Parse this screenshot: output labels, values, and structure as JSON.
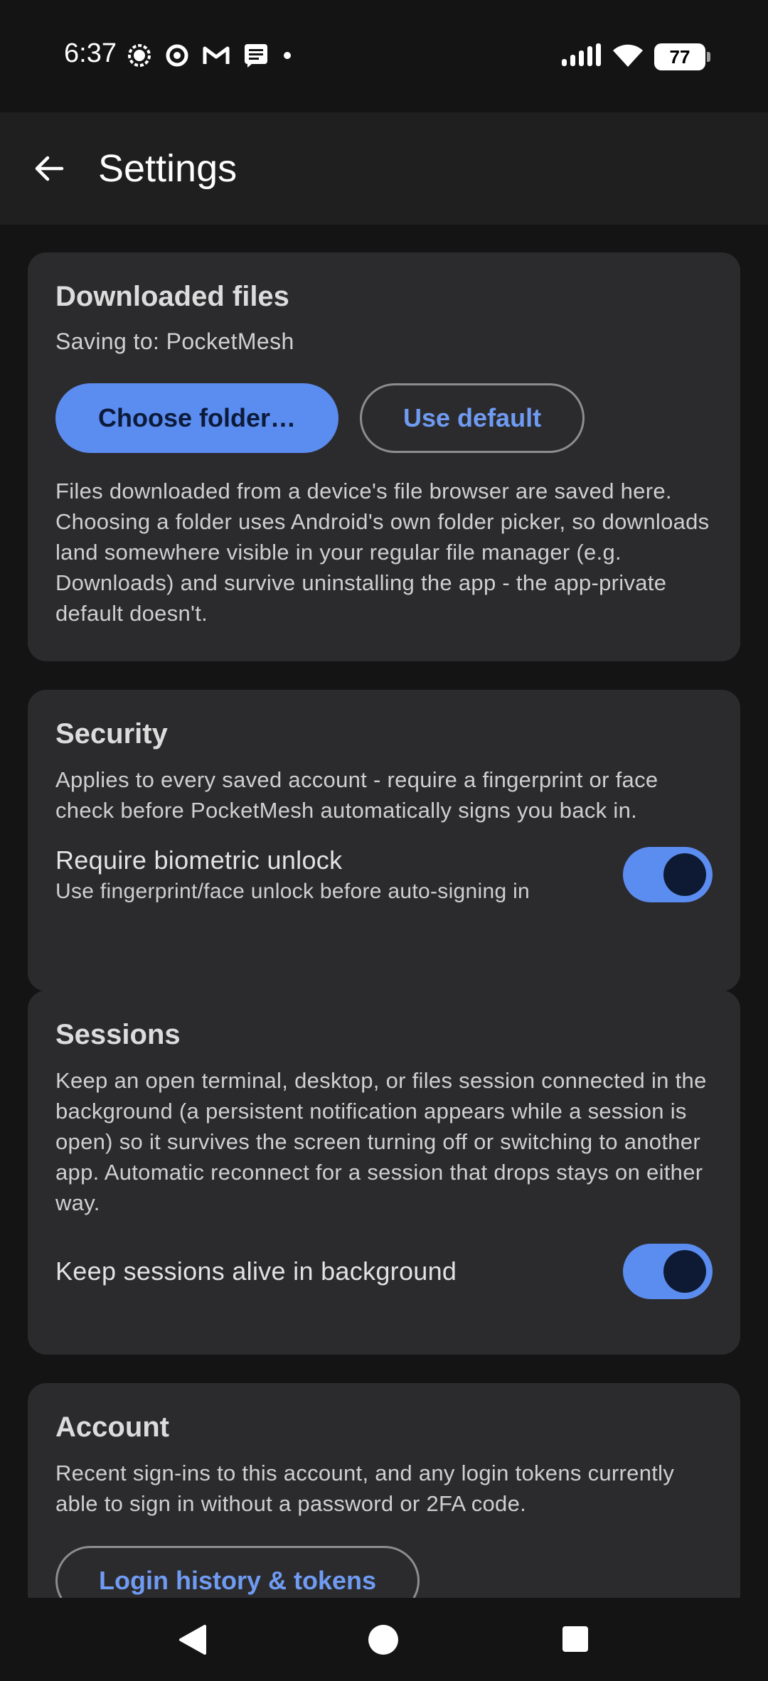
{
  "status": {
    "time": "6:37",
    "battery": "77",
    "left_icons": [
      "signal-messenger-icon",
      "circle-app-icon",
      "gmail-icon",
      "message-icon",
      "dot-icon"
    ],
    "right_icons": [
      "cell-signal-icon",
      "wifi-icon",
      "battery-icon"
    ]
  },
  "app_bar": {
    "title": "Settings"
  },
  "downloads": {
    "title": "Downloaded files",
    "saving_to": "Saving to: PocketMesh",
    "choose_label": "Choose folder…",
    "default_label": "Use default",
    "body": "Files downloaded from a device's file browser are saved here. Choosing a folder uses Android's own folder picker, so downloads land somewhere visible in your regular file manager (e.g. Downloads) and survive uninstalling the app - the app-private default doesn't."
  },
  "security": {
    "title": "Security",
    "body": "Applies to every saved account - require a fingerprint or face check before PocketMesh automatically signs you back in.",
    "setting_label": "Require biometric unlock",
    "setting_desc": "Use fingerprint/face unlock before auto-signing in",
    "enabled": true
  },
  "sessions": {
    "title": "Sessions",
    "body": "Keep an open terminal, desktop, or files session connected in the background (a persistent notification appears while a session is open) so it survives the screen turning off or switching to another app. Automatic reconnect for a session that drops stays on either way.",
    "setting_label": "Keep sessions alive in background",
    "enabled": true
  },
  "account": {
    "title": "Account",
    "body": "Recent sign-ins to this account, and any login tokens currently able to sign in without a password or 2FA code.",
    "button_label": "Login history & tokens"
  },
  "colors": {
    "accent": "#5b8cf0",
    "card": "#2b2b2e",
    "background": "#141414"
  }
}
